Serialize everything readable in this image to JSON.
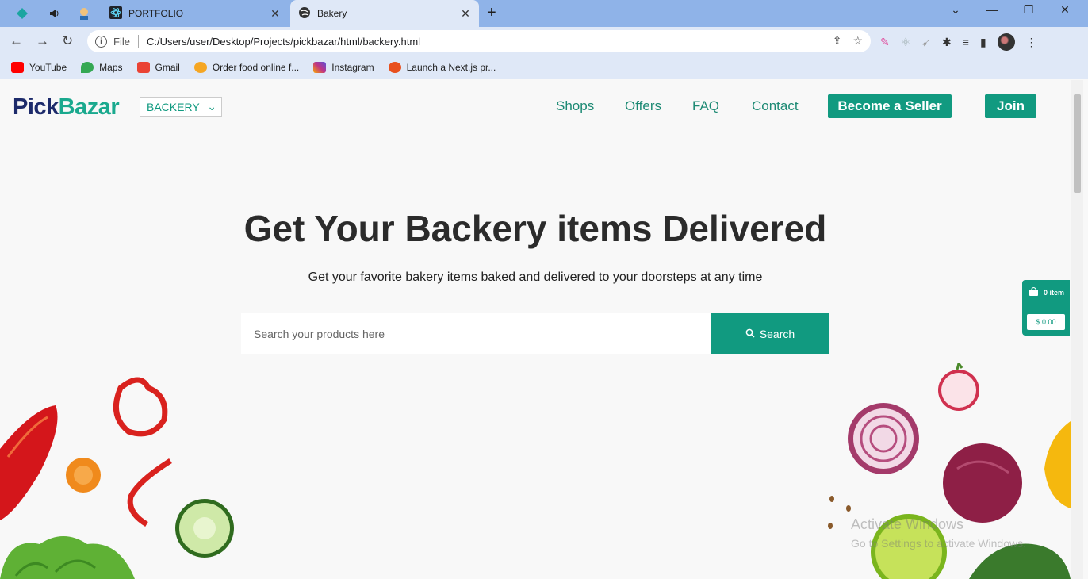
{
  "browser": {
    "tabs": [
      {
        "title": "PORTFOLIO",
        "active": false
      },
      {
        "title": "Bakery",
        "active": true
      }
    ],
    "address": {
      "scheme_label": "File",
      "url": "C:/Users/user/Desktop/Projects/pickbazar/html/backery.html"
    },
    "bookmarks": [
      {
        "label": "YouTube",
        "color": "#ff0000"
      },
      {
        "label": "Maps",
        "color": "#34a853"
      },
      {
        "label": "Gmail",
        "color": "#ea4335"
      },
      {
        "label": "Order food online f...",
        "color": "#f5a623"
      },
      {
        "label": "Instagram",
        "color": "#c13584"
      },
      {
        "label": "Launch a Next.js pr...",
        "color": "#e8501e"
      }
    ]
  },
  "site": {
    "logo": {
      "part1": "Pick",
      "part2": "Bazar"
    },
    "category_select": "BACKERY",
    "nav": [
      "Shops",
      "Offers",
      "FAQ",
      "Contact"
    ],
    "seller_button": "Become a Seller",
    "join_button": "Join",
    "hero": {
      "title": "Get Your Backery items Delivered",
      "subtitle": "Get your favorite bakery items baked and delivered to your doorsteps at any time"
    },
    "search": {
      "placeholder": "Search your products here",
      "button": "Search"
    },
    "cart": {
      "items": "0 item",
      "total": "$ 0.00"
    }
  },
  "os": {
    "watermark_title": "Activate Windows",
    "watermark_sub": "Go to Settings to activate Windows."
  },
  "colors": {
    "brand": "#119a80",
    "logo_dark": "#1d2b6b",
    "tabbar": "#8fb3e8"
  }
}
